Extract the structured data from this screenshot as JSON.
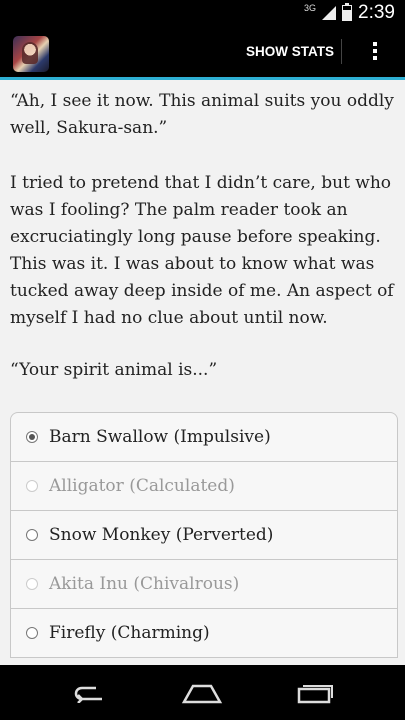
{
  "status_bar": {
    "network": "3G",
    "time": "2:39",
    "battery_level": 0.7
  },
  "action_bar": {
    "show_stats_label": "SHOW STATS"
  },
  "story": {
    "paragraphs": [
      "“Ah, I see it now. This animal suits you oddly well, Sakura-san.”",
      "I tried to pretend that I didn’t care, but who was I fooling? The palm reader took an excruciatingly long pause before speaking. This was it. I was about to know what was tucked away deep inside of me. An aspect of myself I had no clue about until now.",
      "“Your spirit animal is...”"
    ]
  },
  "choices": [
    {
      "label": "Barn Swallow (Impulsive)",
      "selected": true,
      "enabled": true
    },
    {
      "label": "Alligator (Calculated)",
      "selected": false,
      "enabled": false
    },
    {
      "label": "Snow Monkey (Perverted)",
      "selected": false,
      "enabled": true
    },
    {
      "label": "Akita Inu (Chivalrous)",
      "selected": false,
      "enabled": false
    },
    {
      "label": "Firefly (Charming)",
      "selected": false,
      "enabled": true
    }
  ],
  "nav_bar": {
    "icons": [
      "back-icon",
      "home-icon",
      "recent-apps-icon"
    ]
  },
  "colors": {
    "accent": "#2eb0d4",
    "background": "#f2f2f2"
  }
}
